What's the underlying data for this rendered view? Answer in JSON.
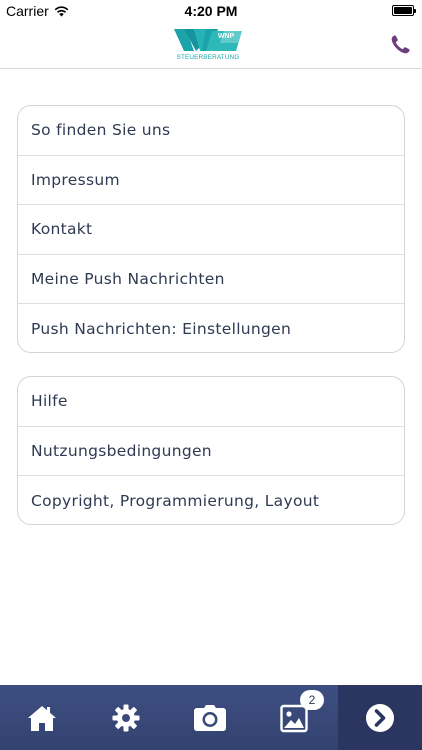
{
  "status_bar": {
    "carrier": "Carrier",
    "time": "4:20 PM"
  },
  "header": {
    "logo_text": "WNP",
    "logo_caption": "STEUERBERATUNG",
    "phone_icon": "phone-icon"
  },
  "menu": {
    "group1": [
      {
        "label": "So finden Sie uns"
      },
      {
        "label": "Impressum"
      },
      {
        "label": "Kontakt"
      },
      {
        "label": "Meine Push Nachrichten"
      },
      {
        "label": "Push Nachrichten: Einstellungen"
      }
    ],
    "group2": [
      {
        "label": "Hilfe"
      },
      {
        "label": "Nutzungsbedingungen"
      },
      {
        "label": "Copyright, Programmierung, Layout"
      }
    ]
  },
  "tab_bar": {
    "icons": [
      "home-icon",
      "gear-icon",
      "camera-icon",
      "gallery-icon",
      "chevron-right-icon"
    ],
    "gallery_badge": "2"
  },
  "colors": {
    "brand_teal": "#1aa3a8",
    "tab_bar": "#3d4e82",
    "phone_icon": "#6b3d7d",
    "menu_text": "#2f3a52"
  }
}
